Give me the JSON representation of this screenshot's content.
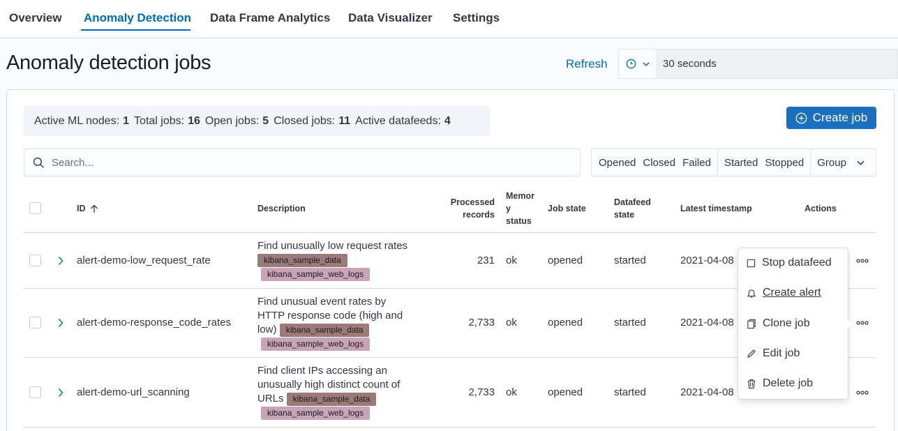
{
  "tabs": [
    {
      "label": "Overview"
    },
    {
      "label": "Anomaly Detection"
    },
    {
      "label": "Data Frame Analytics"
    },
    {
      "label": "Data Visualizer"
    },
    {
      "label": "Settings"
    }
  ],
  "page_title": "Anomaly detection jobs",
  "refresh_label": "Refresh",
  "refresh_interval": "30 seconds",
  "stats": {
    "active_ml_nodes_label": "Active ML nodes:",
    "active_ml_nodes": "1",
    "total_jobs_label": "Total jobs:",
    "total_jobs": "16",
    "open_jobs_label": "Open jobs:",
    "open_jobs": "5",
    "closed_jobs_label": "Closed jobs:",
    "closed_jobs": "11",
    "active_datafeeds_label": "Active datafeeds:",
    "active_datafeeds": "4"
  },
  "create_job_label": "Create job",
  "search_placeholder": "Search...",
  "filters": {
    "opened": "Opened",
    "closed": "Closed",
    "failed": "Failed",
    "started": "Started",
    "stopped": "Stopped",
    "group": "Group"
  },
  "columns": {
    "id": "ID",
    "description": "Description",
    "processed_1": "Processed",
    "processed_2": "records",
    "memory_1": "Memor",
    "memory_2": "y",
    "memory_3": "status",
    "job_state": "Job state",
    "datafeed_1": "Datafeed",
    "datafeed_2": "state",
    "latest_timestamp": "Latest timestamp",
    "actions": "Actions"
  },
  "rows": [
    {
      "id": "alert-demo-low_request_rate",
      "desc_lines": [
        "Find unusually low request rates"
      ],
      "badge1": "kibana_sample_data",
      "badge2": "kibana_sample_web_logs",
      "processed": "231",
      "memory": "ok",
      "job_state": "opened",
      "datafeed_state": "started",
      "timestamp": "2021-04-08"
    },
    {
      "id": "alert-demo-response_code_rates",
      "desc_lines": [
        "Find unusual event rates by",
        "HTTP response code (high and",
        "low)"
      ],
      "badge1": "kibana_sample_data",
      "badge2": "kibana_sample_web_logs",
      "processed": "2,733",
      "memory": "ok",
      "job_state": "opened",
      "datafeed_state": "started",
      "timestamp": "2021-04-08"
    },
    {
      "id": "alert-demo-url_scanning",
      "desc_lines": [
        "Find client IPs accessing an",
        "unusually high distinct count of",
        "URLs"
      ],
      "badge1": "kibana_sample_data",
      "badge2": "kibana_sample_web_logs",
      "processed": "2,733",
      "memory": "ok",
      "job_state": "opened",
      "datafeed_state": "started",
      "timestamp": "2021-04-08"
    }
  ],
  "actions_menu": [
    {
      "label": "Stop datafeed",
      "icon": "square-icon"
    },
    {
      "label": "Create alert",
      "icon": "bell-icon"
    },
    {
      "label": "Clone job",
      "icon": "copy-icon"
    },
    {
      "label": "Edit job",
      "icon": "pencil-icon"
    },
    {
      "label": "Delete job",
      "icon": "trash-icon"
    }
  ],
  "colors": {
    "accent": "#006bb8",
    "primary_button": "#1b6fbd",
    "badge_dark": "#9c7a78",
    "badge_light": "#c9a3b6"
  }
}
